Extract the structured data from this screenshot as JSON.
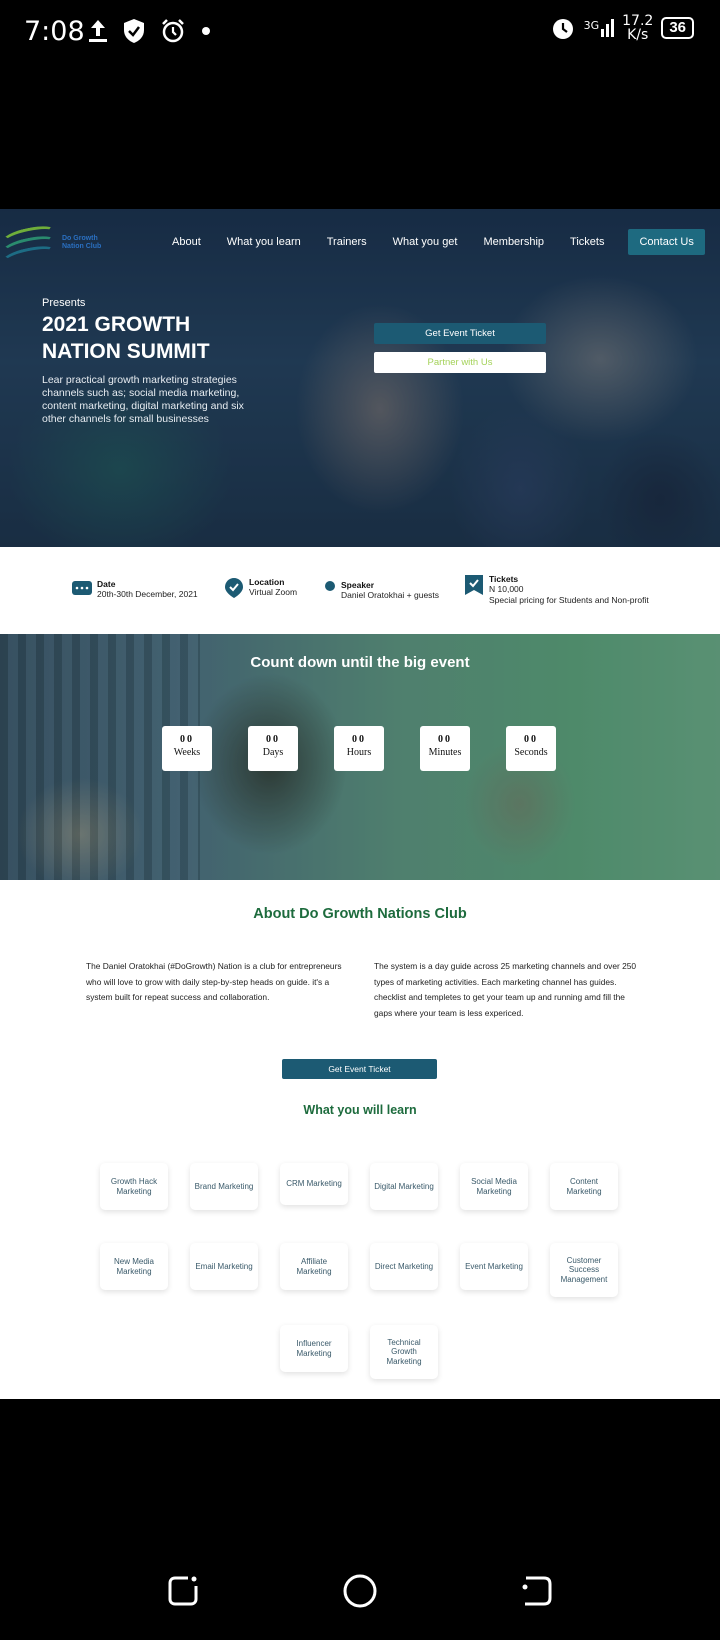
{
  "status_bar": {
    "time": "7:08",
    "network_type": "3G",
    "speed_value": "17.2",
    "speed_unit": "K/s",
    "battery": "36"
  },
  "header": {
    "logo_text": "Do Growth Nation Club",
    "nav": [
      "About",
      "What you learn",
      "Trainers",
      "What you get",
      "Membership",
      "Tickets"
    ],
    "contact_label": "Contact Us"
  },
  "hero": {
    "presents": "Presents",
    "title": "2021 GROWTH NATION SUMMIT",
    "description": "Lear practical growth marketing strategies channels such as; social media marketing, content marketing, digital marketing and six other channels for small businesses",
    "ticket_button": "Get Event Ticket",
    "partner_button": "Partner with Us"
  },
  "info": {
    "date": {
      "label": "Date",
      "value": "20th-30th December, 2021"
    },
    "location": {
      "label": "Location",
      "value": "Virtual Zoom"
    },
    "speaker": {
      "label": "Speaker",
      "value": "Daniel Oratokhai + guests"
    },
    "tickets": {
      "label": "Tickets",
      "price": "N 10,000",
      "note": "Special pricing for Students and Non-profit"
    }
  },
  "countdown": {
    "title": "Count down until the big event",
    "units": [
      {
        "value": "00",
        "label": "Weeks"
      },
      {
        "value": "00",
        "label": "Days"
      },
      {
        "value": "00",
        "label": "Hours"
      },
      {
        "value": "00",
        "label": "Minutes"
      },
      {
        "value": "00",
        "label": "Seconds"
      }
    ]
  },
  "about": {
    "title": "About Do Growth Nations Club",
    "left_text": "The Daniel Oratokhai (#DoGrowth) Nation is a club for entrepreneurs who will love to grow with daily step-by-step heads on guide. it's a system built for repeat success and collaboration.",
    "right_text": "The system is a day guide across 25 marketing channels and over 250 types of marketing activities. Each marketing channel has guides. checklist and templetes to get your team up and running amd fill the gaps where your team is less expericed.",
    "button": "Get Event Ticket"
  },
  "learn": {
    "title": "What you will learn",
    "items": [
      "Growth Hack Marketing",
      "Brand Marketing",
      "CRM Marketing",
      "Digital Marketing",
      "Social Media Marketing",
      "Content Marketing",
      "New Media Marketing",
      "Email Marketing",
      "Affiliate Marketing",
      "Direct Marketing",
      "Event Marketing",
      "Customer Success Management",
      "Influencer Marketing",
      "Technical Growth Marketing"
    ]
  },
  "colors": {
    "primary": "#1c5a73",
    "heading_green": "#1d6b3d",
    "partner_text": "#a4d25a"
  }
}
